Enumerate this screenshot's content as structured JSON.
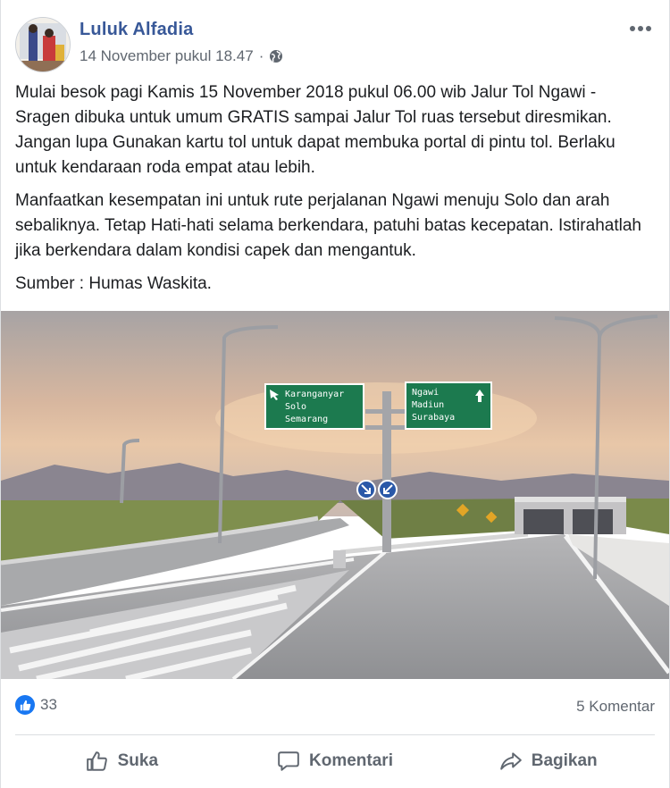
{
  "post": {
    "author": "Luluk Alfadia",
    "timestamp": "14 November pukul 18.47",
    "privacy_icon": "globe-icon",
    "more_icon": "more-options-icon",
    "paragraphs": [
      "Mulai besok pagi Kamis 15 November 2018 pukul 06.00 wib Jalur Tol Ngawi - Sragen dibuka untuk umum GRATIS sampai Jalur Tol ruas tersebut diresmikan. Jangan lupa Gunakan kartu tol untuk dapat membuka portal di pintu tol. Berlaku untuk kendaraan roda empat atau lebih.",
      "Manfaatkan kesempatan ini untuk rute perjalanan Ngawi menuju Solo dan arah sebaliknya. Tetap Hati-hati selama berkendara, patuhi batas kecepatan. Istirahatlah jika berkendara dalam kondisi capek dan mengantuk.",
      "Sumber : Humas Waskita."
    ]
  },
  "photo": {
    "sign_left": [
      "Karanganyar",
      "Solo",
      "Semarang"
    ],
    "sign_right": [
      "Ngawi",
      "Madiun",
      "Surabaya"
    ]
  },
  "stats": {
    "likes": "33",
    "comments": "5 Komentar"
  },
  "actions": {
    "like": "Suka",
    "comment": "Komentari",
    "share": "Bagikan"
  },
  "colors": {
    "name_link": "#385898",
    "like_blue": "#1877f2",
    "sign_green": "#1c7a4f"
  }
}
